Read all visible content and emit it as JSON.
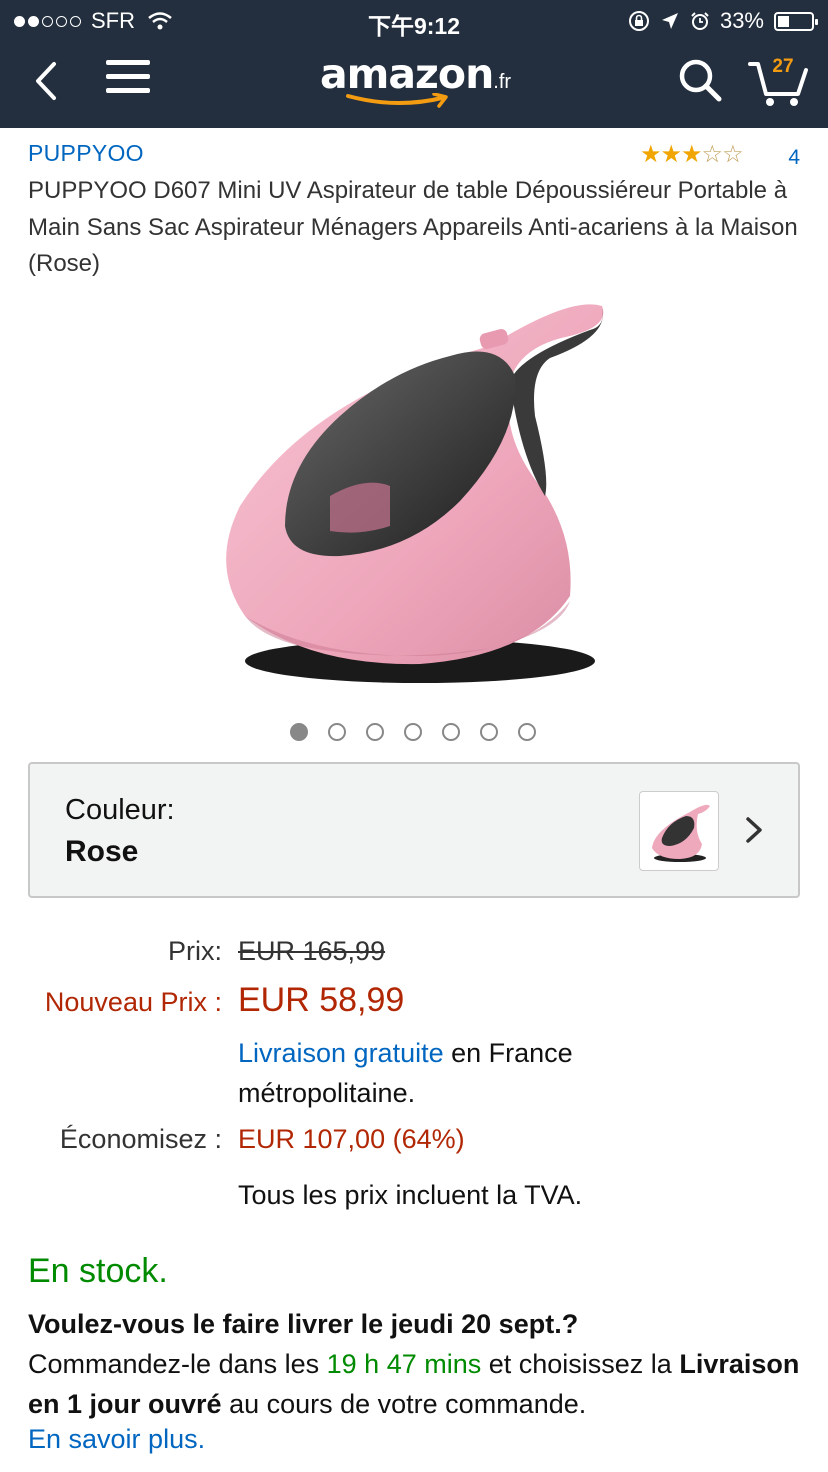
{
  "status_bar": {
    "carrier": "SFR",
    "time": "下午9:12",
    "battery": "33%",
    "battery_level": 0.33
  },
  "nav": {
    "logo_text": "amazon",
    "logo_tld": ".fr",
    "cart_count": "27"
  },
  "product": {
    "brand": "PUPPYOO",
    "rating_stars": 3,
    "rating_max": 5,
    "review_count": "4",
    "title": "PUPPYOO D607 Mini UV Aspirateur de table Dépoussiéreur Portable à Main Sans Sac Aspirateur Ménagers Appareils Anti-acariens à la Maison (Rose)",
    "image_count": 7,
    "active_image": 1
  },
  "color": {
    "label": "Couleur:",
    "value": "Rose"
  },
  "pricing": {
    "price_label": "Prix:",
    "price_value": "EUR 165,99",
    "new_price_label": "Nouveau Prix :",
    "new_price_value": "EUR 58,99",
    "shipping_link": "Livraison gratuite",
    "shipping_rest": " en France métropolitaine.",
    "savings_label": "Économisez :",
    "savings_value": "EUR 107,00 (64%)",
    "tax_note": "Tous les prix incluent la TVA."
  },
  "availability": {
    "stock": "En stock.",
    "question": "Voulez-vous le faire livrer le jeudi 20 sept.?",
    "order_prefix": "Commandez-le dans les ",
    "countdown": "19 h 47 mins",
    "order_middle": " et choisissez la ",
    "option": "Livraison en 1 jour ouvré",
    "order_suffix": " au cours de votre commande.",
    "learn_more": "En savoir plus."
  },
  "colors": {
    "header_bg": "#232f3e",
    "link": "#0066c0",
    "price_red": "#b12704",
    "stock_green": "#008a00",
    "star": "#f0a500"
  }
}
